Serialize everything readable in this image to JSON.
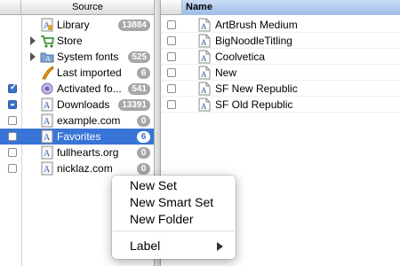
{
  "sources": {
    "header": "Source",
    "items": [
      {
        "label": "Library",
        "badge": "13884",
        "check": "none",
        "icon": "library-icon",
        "expandable": false
      },
      {
        "label": "Store",
        "badge": "",
        "check": "none",
        "icon": "store-cart-icon",
        "expandable": true
      },
      {
        "label": "System fonts",
        "badge": "525",
        "check": "none",
        "icon": "system-fonts-folder-icon",
        "expandable": true
      },
      {
        "label": "Last imported",
        "badge": "6",
        "check": "none",
        "icon": "last-imported-icon",
        "expandable": false
      },
      {
        "label": "Activated fo...",
        "badge": "541",
        "check": "checked",
        "icon": "activated-fonts-icon",
        "expandable": false
      },
      {
        "label": "Downloads",
        "badge": "13391",
        "check": "mixed",
        "icon": "downloads-icon",
        "expandable": false
      },
      {
        "label": "example.com",
        "badge": "0",
        "check": "unchecked",
        "icon": "set-font-icon",
        "expandable": false
      },
      {
        "label": "Favorites",
        "badge": "6",
        "check": "unchecked",
        "icon": "set-font-icon",
        "expandable": false,
        "selected": true
      },
      {
        "label": "fullhearts.org",
        "badge": "0",
        "check": "unchecked",
        "icon": "set-font-icon",
        "expandable": false
      },
      {
        "label": "nicklaz.com",
        "badge": "0",
        "check": "unchecked",
        "icon": "set-font-icon",
        "expandable": false
      }
    ]
  },
  "fonts": {
    "header": "Name",
    "items": [
      {
        "label": "ArtBrush Medium"
      },
      {
        "label": "BigNoodleTitling"
      },
      {
        "label": "Coolvetica"
      },
      {
        "label": "New"
      },
      {
        "label": "SF New Republic"
      },
      {
        "label": "SF Old Republic"
      }
    ]
  },
  "context_menu": {
    "items": [
      {
        "label": "New Set"
      },
      {
        "label": "New Smart Set"
      },
      {
        "label": "New Folder"
      },
      {
        "label": "Label",
        "submenu": true
      }
    ]
  },
  "colors": {
    "selection": "#3875d7",
    "badge": "#a7a7a7",
    "name_header": "#9ebcea"
  }
}
